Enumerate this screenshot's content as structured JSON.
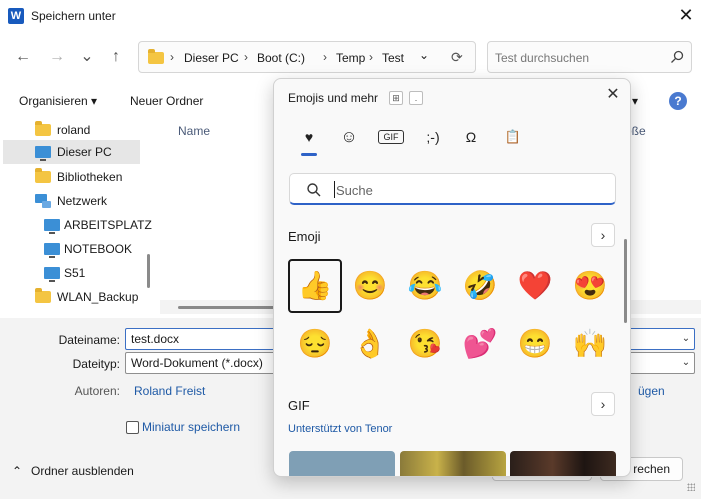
{
  "window": {
    "app_icon": "W",
    "title": "Speichern unter",
    "close_glyph": "✕"
  },
  "nav": {
    "back": "←",
    "forward": "→",
    "recent": "⌄",
    "up": "↑"
  },
  "address": {
    "crumbs": [
      "Dieser PC",
      "Boot (C:)",
      "Temp",
      "Test"
    ],
    "separator": "›",
    "dropdown": "⌄",
    "refresh": "⟳"
  },
  "search": {
    "placeholder": "Test durchsuchen"
  },
  "toolbar": {
    "organize": "Organisieren",
    "organize_arrow": "▾",
    "new_folder": "Neuer Ordner",
    "view_arrow": "▾",
    "help": "?"
  },
  "sidebar": {
    "items": [
      {
        "label": "roland"
      },
      {
        "label": "Dieser PC"
      },
      {
        "label": "Bibliotheken"
      },
      {
        "label": "Netzwerk"
      },
      {
        "label": "ARBEITSPLATZ"
      },
      {
        "label": "NOTEBOOK"
      },
      {
        "label": "S51"
      },
      {
        "label": "WLAN_Backup"
      }
    ]
  },
  "filelist": {
    "col_name": "Name",
    "col_size_partial": "öße"
  },
  "form": {
    "filename_label": "Dateiname:",
    "filename_value": "test.docx",
    "filetype_label": "Dateityp:",
    "filetype_value": "Word-Dokument (*.docx)",
    "authors_label": "Autoren:",
    "authors_value": "Roland Freist",
    "add_partial": "ügen",
    "thumbnail_label": "Miniatur speichern",
    "hide_folders": "Ordner ausblenden",
    "hide_arrow": "⌃",
    "cancel_partial": "rechen",
    "dd_arrow": "⌄"
  },
  "emoji_panel": {
    "title": "Emojis und mehr",
    "key1": "⊞",
    "key2": ".",
    "close": "✕",
    "tabs": [
      "♥",
      "☺",
      "GIF",
      ";-)",
      "Ω",
      "📋"
    ],
    "search_placeholder": "Suche",
    "emoji_section": "Emoji",
    "more": "›",
    "emojis": [
      "👍",
      "😊",
      "😂",
      "🤣",
      "❤️",
      "😍",
      "😔",
      "👌",
      "😘",
      "💕",
      "😁",
      "🙌"
    ],
    "gif_section": "GIF",
    "gif_more": "›",
    "tenor": "Unterstützt von Tenor"
  },
  "colors": {
    "accent": "#2e62c7",
    "link": "#1f5aa6"
  }
}
